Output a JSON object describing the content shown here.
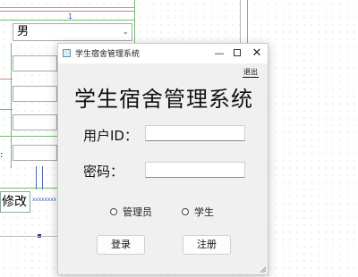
{
  "background": {
    "gender_combo_value": "男",
    "modify_button_label": "修改",
    "small_text": "xxxxxxxx",
    "marker": "1"
  },
  "dialog": {
    "window_title": "学生宿舍管理系统",
    "exit_label": "退出",
    "heading": "学生宿舍管理系统",
    "user_id_label": "用户ID：",
    "user_id_value": "",
    "password_label": "密码：",
    "password_value": "",
    "roles": [
      {
        "label": "管理员",
        "selected": false
      },
      {
        "label": "学生",
        "selected": false
      }
    ],
    "login_label": "登录",
    "register_label": "注册"
  }
}
